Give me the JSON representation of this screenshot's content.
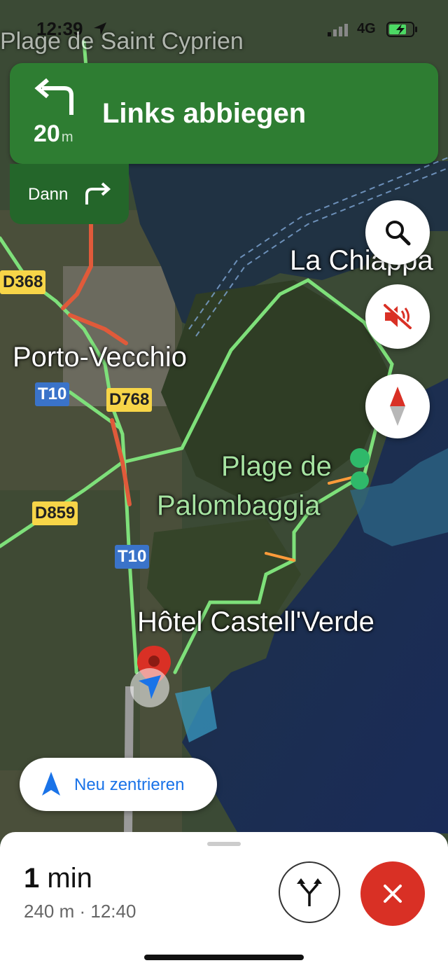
{
  "status_bar": {
    "time": "12:39",
    "network": "4G"
  },
  "navigation": {
    "instruction": "Links abbiegen",
    "distance": "20",
    "distance_unit": "m",
    "then_label": "Dann",
    "accent_color": "#2e7d32"
  },
  "map": {
    "labels": {
      "top_partial": "Plage de Saint Cyprien",
      "la_chiappa": "La Chiappa",
      "porto_vecchio": "Porto-Vecchio",
      "plage_line1": "Plage de",
      "plage_line2": "Palombaggia",
      "hotel": "Hôtel Castell'Verde"
    },
    "road_shields": {
      "d368": "D368",
      "t10_a": "T10",
      "d768": "D768",
      "d859": "D859",
      "t10_b": "T10"
    }
  },
  "buttons": {
    "recenter_label": "Neu zentrieren"
  },
  "trip": {
    "eta_number": "1",
    "eta_unit": "min",
    "details": "240 m · 12:40"
  }
}
